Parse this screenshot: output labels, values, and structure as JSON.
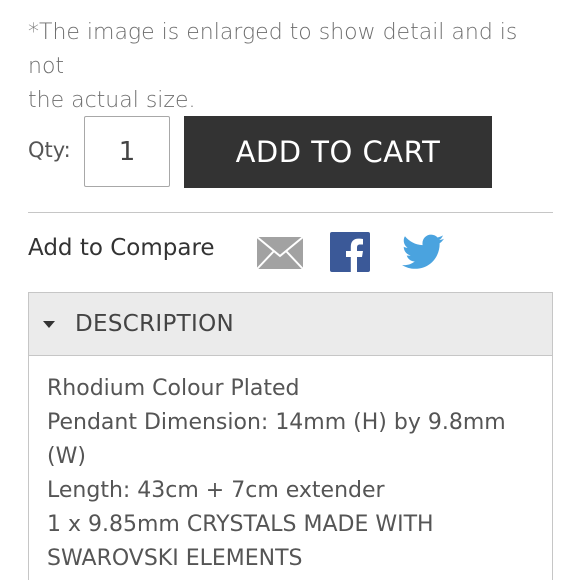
{
  "note": {
    "line1": "*The image is enlarged to show detail and is not",
    "line2": "the actual size."
  },
  "purchase": {
    "qty_label": "Qty:",
    "qty_value": "1",
    "add_to_cart_label": "ADD TO CART"
  },
  "compare": {
    "label": "Add to Compare"
  },
  "share": {
    "icons": [
      "mail-icon",
      "facebook-icon",
      "twitter-icon"
    ],
    "colors": {
      "mail": "#9a9a9a",
      "facebook": "#3b5998",
      "twitter": "#4aa3df"
    }
  },
  "description": {
    "title": "DESCRIPTION",
    "lines": [
      "Rhodium Colour Plated",
      "Pendant Dimension: 14mm (H) by 9.8mm",
      "(W)",
      "Length: 43cm + 7cm extender",
      "1 x 9.85mm CRYSTALS MADE WITH",
      "SWAROVSKI ELEMENTS"
    ]
  },
  "colors": {
    "button_bg": "#333333",
    "button_text": "#ffffff",
    "panel_header_bg": "#ebebeb",
    "border": "#c6c6c6"
  }
}
